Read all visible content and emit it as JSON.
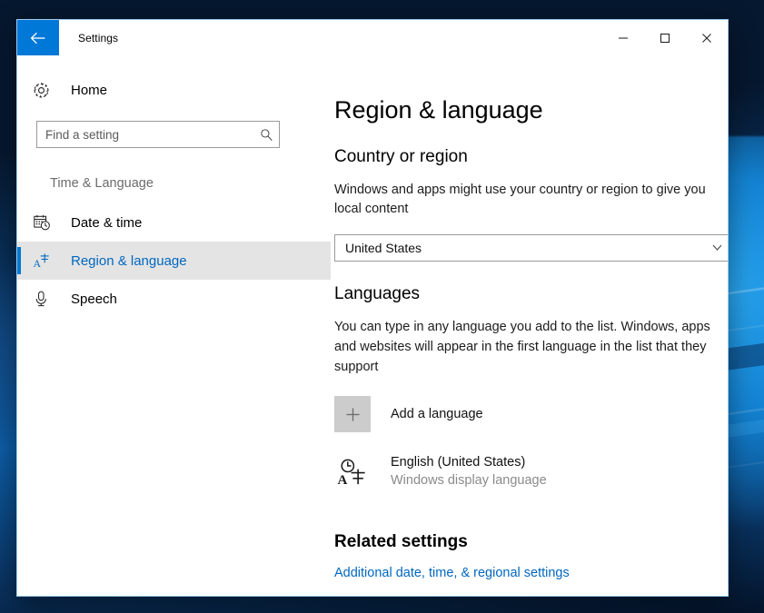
{
  "window": {
    "title": "Settings",
    "back_label": "Back",
    "minimize_label": "Minimize",
    "maximize_label": "Maximize",
    "close_label": "Close",
    "accent_color": "#0078d7",
    "link_color": "#0067c0"
  },
  "sidebar": {
    "home_label": "Home",
    "search": {
      "placeholder": "Find a setting",
      "value": "",
      "icon": "search-icon"
    },
    "category_label": "Time & Language",
    "items": [
      {
        "label": "Date & time",
        "icon": "calendar-clock-icon",
        "selected": false
      },
      {
        "label": "Region & language",
        "icon": "language-region-icon",
        "selected": true
      },
      {
        "label": "Speech",
        "icon": "microphone-icon",
        "selected": false
      }
    ]
  },
  "main": {
    "page_title": "Region & language",
    "country": {
      "heading": "Country or region",
      "description": "Windows and apps might use your country or region to give you local content",
      "selected_value": "United States",
      "chevron_icon": "chevron-down-icon"
    },
    "languages": {
      "heading": "Languages",
      "description": "You can type in any language you add to the list. Windows, apps and websites will appear in the first language in the list that they support",
      "add_label": "Add a language",
      "add_icon": "plus-icon",
      "installed": [
        {
          "name": "English (United States)",
          "sub": "Windows display language",
          "icon": "language-region-icon"
        }
      ]
    },
    "related": {
      "heading": "Related settings",
      "links": [
        {
          "label": "Additional date, time, & regional settings"
        }
      ]
    }
  }
}
